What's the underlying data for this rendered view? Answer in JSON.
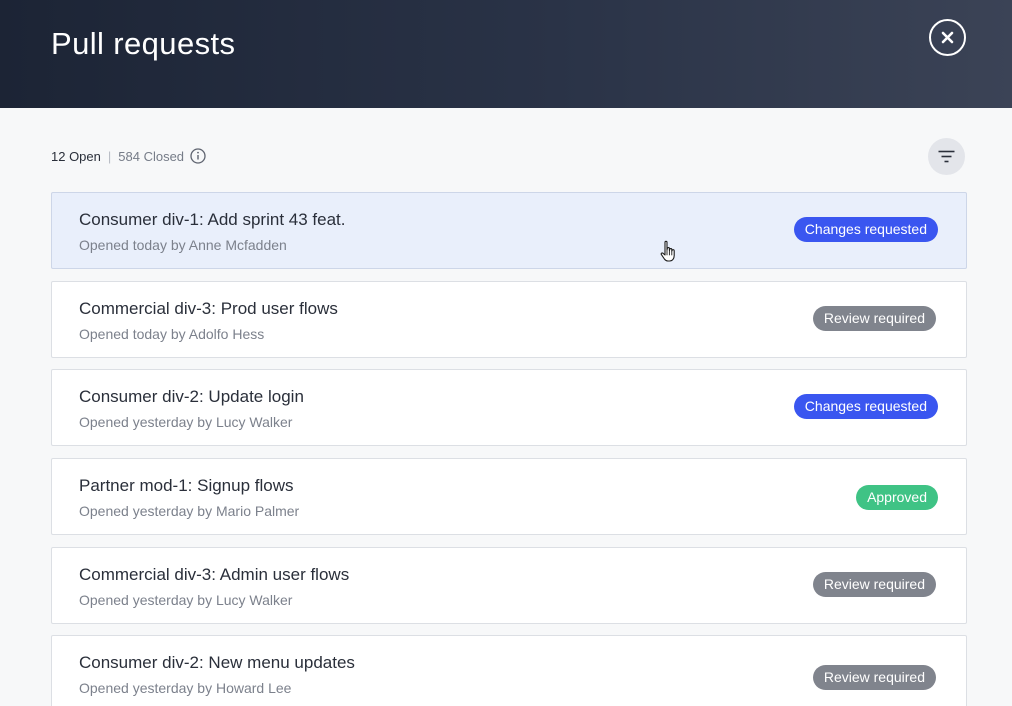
{
  "header": {
    "title": "Pull requests",
    "close_icon": "close-icon"
  },
  "summary": {
    "open": "12 Open",
    "separator": "|",
    "closed": "584 Closed",
    "info_icon": "info-icon"
  },
  "filter_icon": "filter-icon",
  "colors": {
    "changes_requested": "#3a56f0",
    "review_required": "#80848d",
    "approved": "#3fc385",
    "header_dark": "#1c2435"
  },
  "pull_requests": [
    {
      "title": "Consumer div-1: Add sprint 43 feat.",
      "subtitle": "Opened today by Anne Mcfadden",
      "status": "Changes requested"
    },
    {
      "title": "Commercial div-3: Prod user flows",
      "subtitle": "Opened today by Adolfo Hess",
      "status": "Review required"
    },
    {
      "title": "Consumer div-2: Update login",
      "subtitle": "Opened yesterday by Lucy Walker",
      "status": "Changes requested"
    },
    {
      "title": "Partner mod-1: Signup flows",
      "subtitle": "Opened yesterday by Mario Palmer",
      "status": "Approved"
    },
    {
      "title": "Commercial div-3: Admin user flows",
      "subtitle": "Opened yesterday by Lucy Walker",
      "status": "Review required"
    },
    {
      "title": "Consumer div-2: New menu updates",
      "subtitle": "Opened yesterday by Howard Lee",
      "status": "Review required"
    }
  ]
}
